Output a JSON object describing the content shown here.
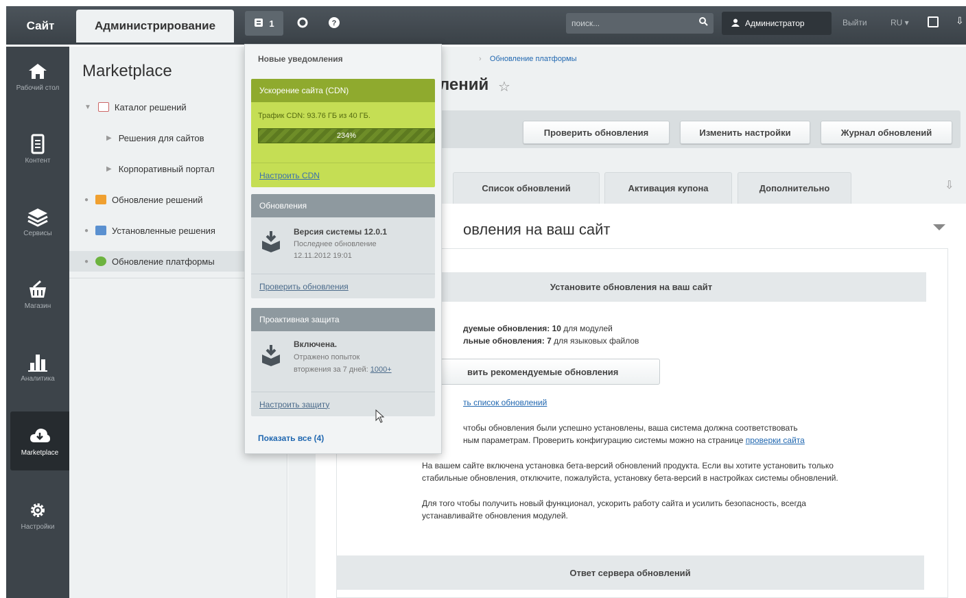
{
  "topbar": {
    "site": "Сайт",
    "admin": "Администрирование",
    "notif_count": "1",
    "search_placeholder": "поиск...",
    "user": "Администратор",
    "logout": "Выйти",
    "lang": "RU"
  },
  "iconbar": [
    {
      "label": "Рабочий стол",
      "icon": "home-icon"
    },
    {
      "label": "Контент",
      "icon": "document-icon"
    },
    {
      "label": "Сервисы",
      "icon": "layers-icon"
    },
    {
      "label": "Магазин",
      "icon": "basket-icon"
    },
    {
      "label": "Аналитика",
      "icon": "chart-icon"
    },
    {
      "label": "Marketplace",
      "icon": "cloud-download-icon"
    },
    {
      "label": "Настройки",
      "icon": "gear-icon"
    }
  ],
  "menu": {
    "title": "Marketplace",
    "items": [
      {
        "label": "Каталог решений"
      },
      {
        "label": "Решения для сайтов"
      },
      {
        "label": "Корпоративный портал"
      },
      {
        "label": "Обновление решений"
      },
      {
        "label": "Установленные решения"
      },
      {
        "label": "Обновление платформы"
      }
    ]
  },
  "main": {
    "breadcrumb_sep": "›",
    "breadcrumb_last": "Обновление платформы",
    "title": "лений",
    "buttons": [
      "Проверить обновления",
      "Изменить настройки",
      "Журнал обновлений"
    ],
    "tabs": [
      "Список обновлений",
      "Активация купона",
      "Дополнительно"
    ],
    "section_title": "овления на ваш сайт",
    "box_title": "Установите обновления на ваш сайт",
    "rec_bold": "дуемые обновления: 10",
    "rec_text": " для модулей",
    "opt_bold": "льные обновления: 7",
    "opt_text": " для языковых файлов",
    "install_btn": "вить рекомендуемые обновления",
    "list_link": "ть список обновлений",
    "note1a": "чтобы обновления были успешно установлены, ваша система должна соответствовать",
    "note1b": "ным параметрам. Проверить конфигурацию системы можно на странице ",
    "note1_link": "проверки сайта",
    "note2a": "На вашем сайте включена установка бета-версий обновлений продукта. Если вы хотите установить только",
    "note2b": "стабильные обновления, отключите, пожалуйста, установку бета-версий в настройках системы обновлений.",
    "note3a": "Для того чтобы получить новый функционал, ускорить работу сайта и усилить безопасность, всегда",
    "note3b": "устанавливайте обновления модулей.",
    "reply_title": "Ответ сервера обновлений"
  },
  "popup": {
    "title": "Новые уведомления",
    "cdn": {
      "head": "Ускорение сайта (CDN)",
      "traffic": "Трафик CDN: 93.76 ГБ из 40 ГБ.",
      "percent": "234%",
      "link": "Настроить CDN"
    },
    "updates": {
      "head": "Обновления",
      "version": "Версия системы 12.0.1",
      "last": "Последнее обновление",
      "date": "12.11.2012 19:01",
      "link": "Проверить обновления"
    },
    "security": {
      "head": "Проактивная защита",
      "status": "Включена.",
      "line1": "Отражено попыток",
      "line2": "вторжения за 7 дней: ",
      "count": "1000+",
      "link": "Настроить защиту"
    },
    "show_all": "Показать все (4)"
  },
  "colors": {
    "accent_link": "#2067b0",
    "cdn_green": "#c5de54",
    "topbar": "#3f474d"
  }
}
